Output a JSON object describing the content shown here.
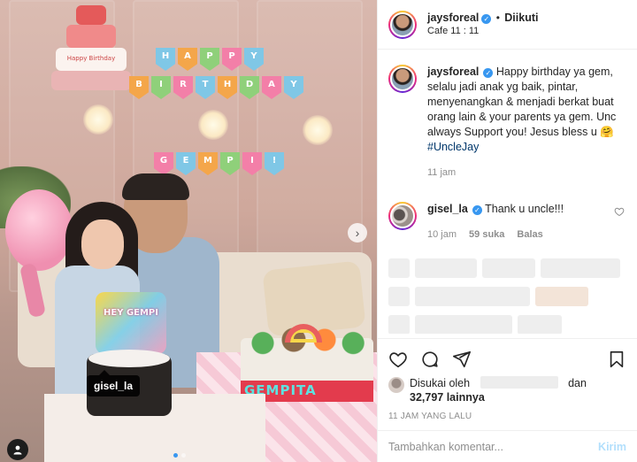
{
  "post": {
    "author": "jaysforeal",
    "follow_status": "Diikuti",
    "location": "Cafe 11 : 11",
    "tagged_user": "gisel_la",
    "cake_text": "GEMPITA",
    "topper_text": "HEY GEMPI",
    "banner_text": "HAPPY BIRTHDAY",
    "name_banner_text": "GEMPI!",
    "mini_cake_text": "Happy Birthday"
  },
  "caption": {
    "username": "jaysforeal",
    "text": "Happy birthday ya gem, selalu jadi anak yg baik, pintar, menyenangkan & menjadi berkat buat orang lain & your parents ya gem. Unc always Support you! Jesus bless u 🤗",
    "hashtag": "#UncleJay",
    "time": "11 jam"
  },
  "reply": {
    "username": "gisel_la",
    "text": "Thank u uncle!!!",
    "time": "10 jam",
    "likes": "59 suka",
    "reply_label": "Balas"
  },
  "likes": {
    "prefix": "Disukai oleh",
    "conj": "dan",
    "count": "32,797 lainnya"
  },
  "timestamp": "11 JAM YANG LALU",
  "comment_input": {
    "placeholder": "Tambahkan komentar...",
    "post_label": "Kirim"
  },
  "colors": {
    "accent": "#3897f0",
    "post_disabled": "#b2dffc"
  }
}
